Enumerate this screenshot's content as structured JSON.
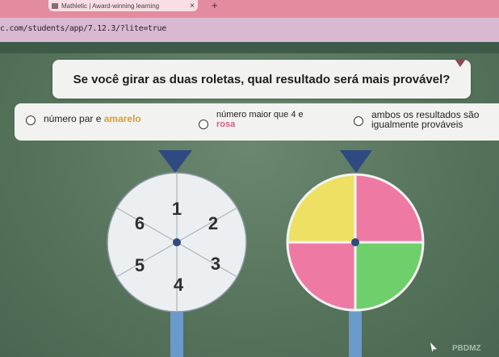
{
  "browser": {
    "tab_title": "Mathletic | Award-winning learning",
    "tab_close": "×",
    "new_tab": "+",
    "url": "c.com/students/app/7.12.3/?lite=true"
  },
  "question": {
    "text": "Se você girar as duas roletas, qual resultado será mais provável?"
  },
  "answers": [
    {
      "pre": "número par e ",
      "hl": "amarelo",
      "post": ""
    },
    {
      "line1": "número maior que 4 e",
      "line2": "rosa"
    },
    {
      "line1": "ambos os resultados são",
      "line2": "igualmente prováveis"
    }
  ],
  "spinner_numbers": {
    "numbers": [
      "1",
      "2",
      "3",
      "4",
      "5",
      "6"
    ]
  },
  "spinner_colors": {
    "sectors": [
      "yellow",
      "pink",
      "green",
      "pink"
    ]
  },
  "colors": {
    "pointer": "#2e4a80",
    "stand": "#6a9acb",
    "yellow": "#ede063",
    "pink": "#ee7aa3",
    "green": "#6fcf6a",
    "number_wheel": "#eceff2"
  },
  "icons": [
    "cursor-icon"
  ],
  "watermark": "PBDMZ"
}
